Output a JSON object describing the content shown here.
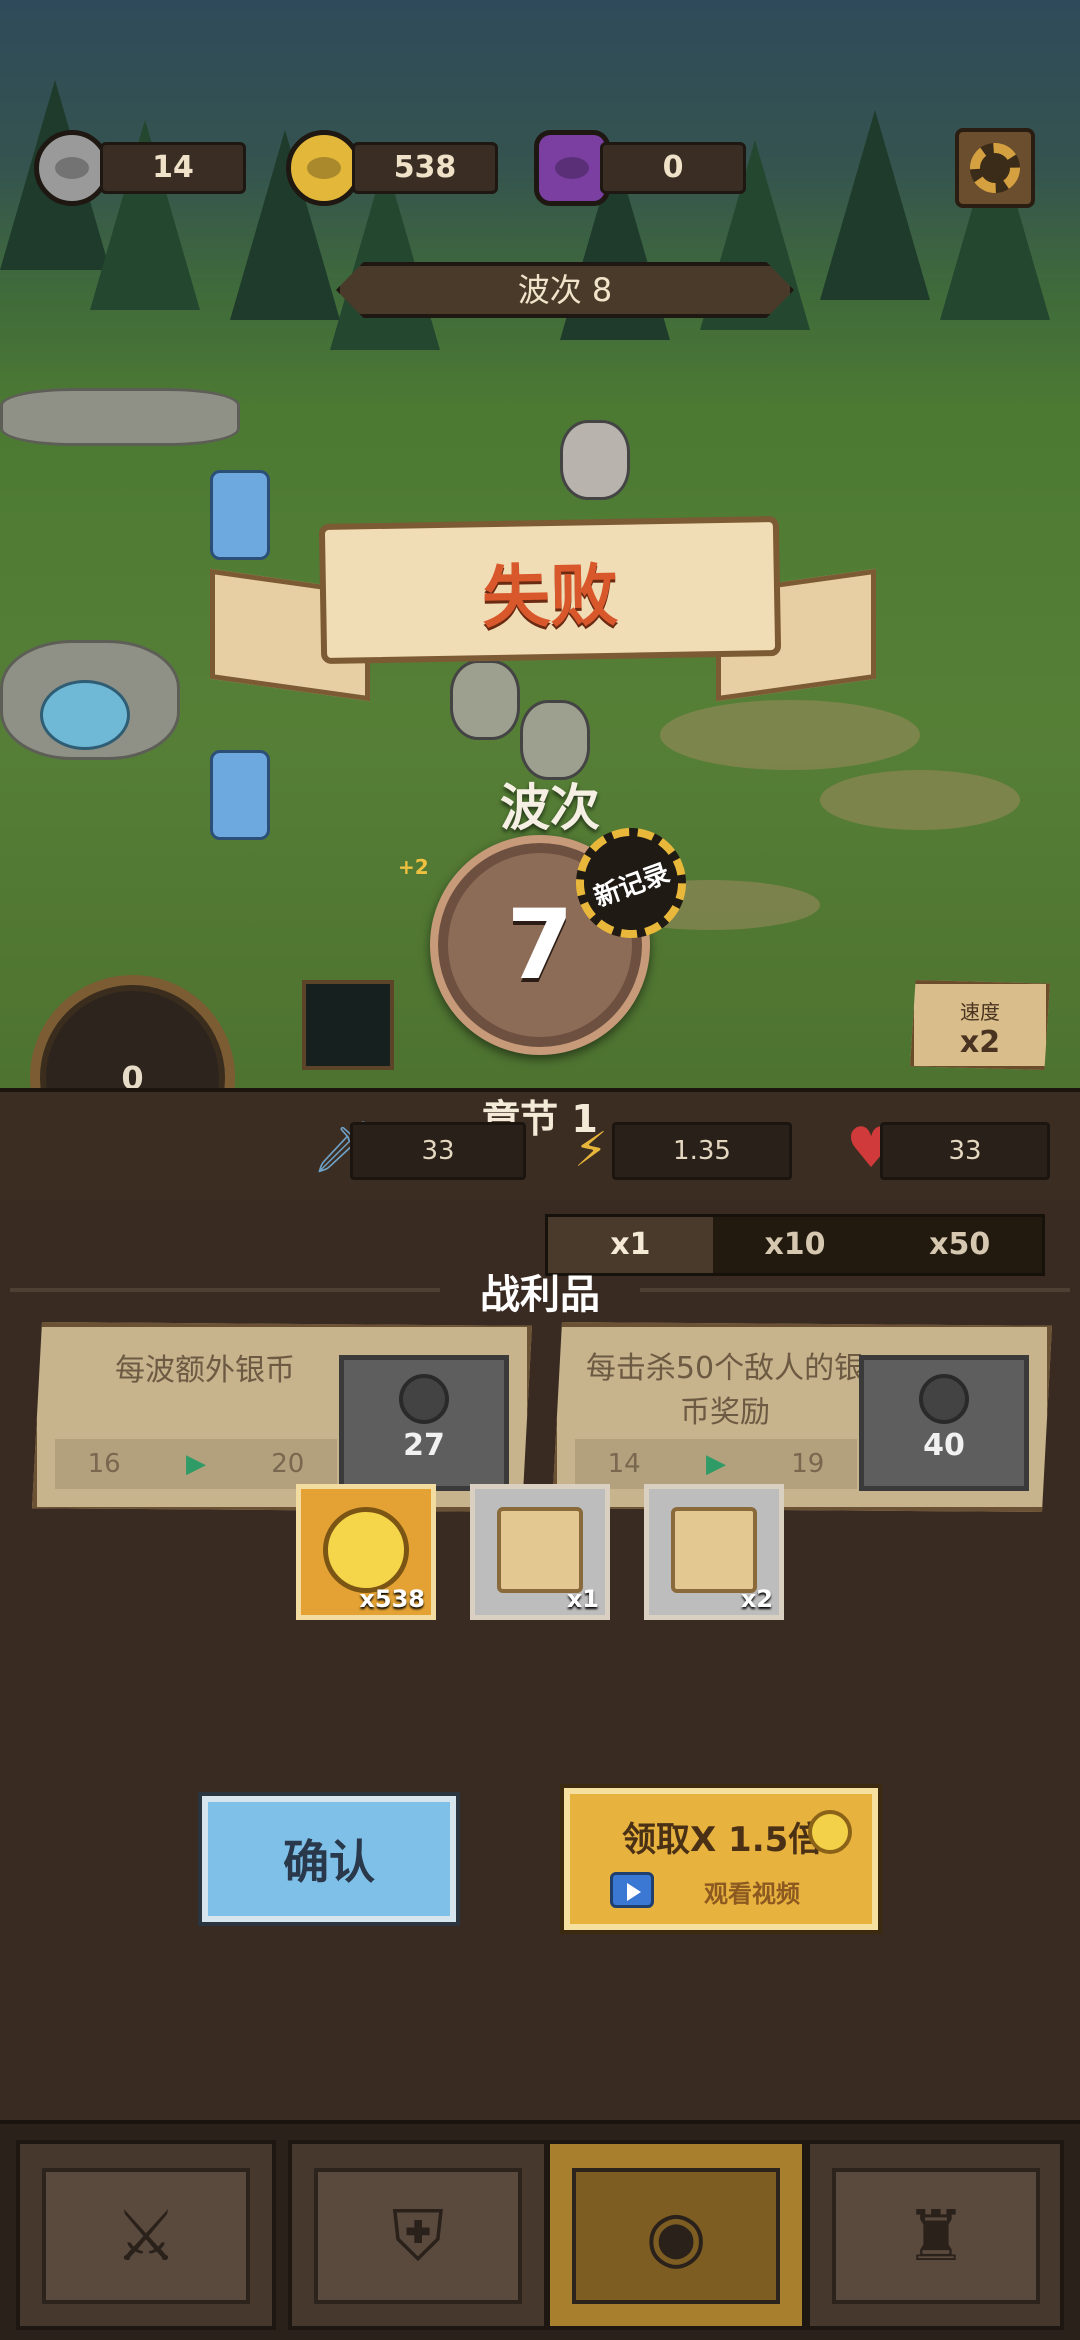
{
  "hud": {
    "resources": [
      {
        "icon": "silver-coin-icon",
        "value": "14",
        "color": "#8f8f8f"
      },
      {
        "icon": "gold-coin-icon",
        "value": "538",
        "color": "#e2b73a"
      },
      {
        "icon": "gem-icon",
        "value": "0",
        "color": "#7a3fa0"
      }
    ],
    "settings_icon": "gear-icon",
    "wave_banner": "波次 8"
  },
  "result": {
    "title": "失败",
    "wave_label": "波次",
    "wave_value": "7",
    "new_record": "新记录",
    "coin_pickup": "+2"
  },
  "speed": {
    "label": "速度",
    "value": "x2"
  },
  "orb": {
    "value": "0"
  },
  "stats": {
    "chapter": "章节 1",
    "attack": "33",
    "attack_speed": "1.35",
    "health": "33"
  },
  "multipliers": {
    "options": [
      "x1",
      "x10",
      "x50"
    ],
    "selected": "x1"
  },
  "loot": {
    "title": "战利品",
    "upgrades": [
      {
        "title": "每波额外银币",
        "from": "16",
        "to": "20",
        "cost": "27"
      },
      {
        "title": "每击杀50个敌人的银币奖励",
        "from": "14",
        "to": "19",
        "cost": "40"
      }
    ],
    "items": [
      {
        "icon": "gold-coin-icon",
        "qty": "x538"
      },
      {
        "icon": "scroll-helmet-icon",
        "qty": "x1"
      },
      {
        "icon": "scroll-ring-icon",
        "qty": "x2"
      }
    ]
  },
  "buttons": {
    "confirm": "确认",
    "claim": "领取X 1.5倍",
    "watch_video": "观看视频"
  },
  "nav": {
    "items": [
      "battle-icon",
      "shield-icon",
      "coin-shop-icon",
      "castle-icon"
    ],
    "active": 2
  }
}
